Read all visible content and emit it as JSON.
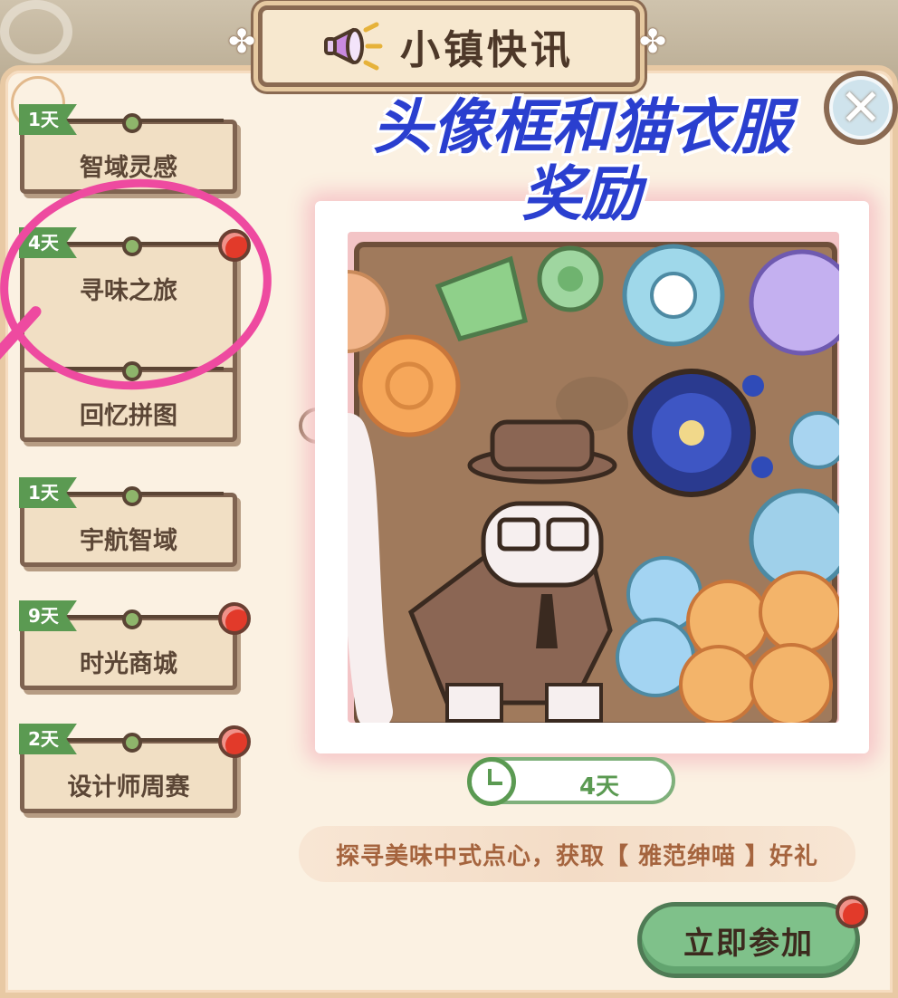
{
  "header": {
    "title": "小镇快讯"
  },
  "overlay_caption": {
    "line1": "头像框和猫衣服",
    "line2": "奖励"
  },
  "sidebar": {
    "items": [
      {
        "label": "智域灵感",
        "days": "1天",
        "badge": false
      },
      {
        "label": "寻味之旅",
        "days": "4天",
        "badge": true,
        "selected": true
      },
      {
        "label": "回忆拼图",
        "days": "",
        "badge": false
      },
      {
        "label": "宇航智域",
        "days": "1天",
        "badge": false
      },
      {
        "label": "时光商城",
        "days": "9天",
        "badge": true
      },
      {
        "label": "设计师周赛",
        "days": "2天",
        "badge": true
      }
    ]
  },
  "event": {
    "time_left": "4天",
    "description": "探寻美味中式点心，获取【 雅范绅喵 】好礼",
    "join_label": "立即参加"
  },
  "colors": {
    "accent_green": "#5b9a52",
    "badge_red": "#e23a2a",
    "annotation_pink": "#ee4aa0",
    "caption_blue": "#2a3fcf"
  },
  "icons": [
    "megaphone-icon",
    "close-icon",
    "clock-icon",
    "clover-icon"
  ]
}
